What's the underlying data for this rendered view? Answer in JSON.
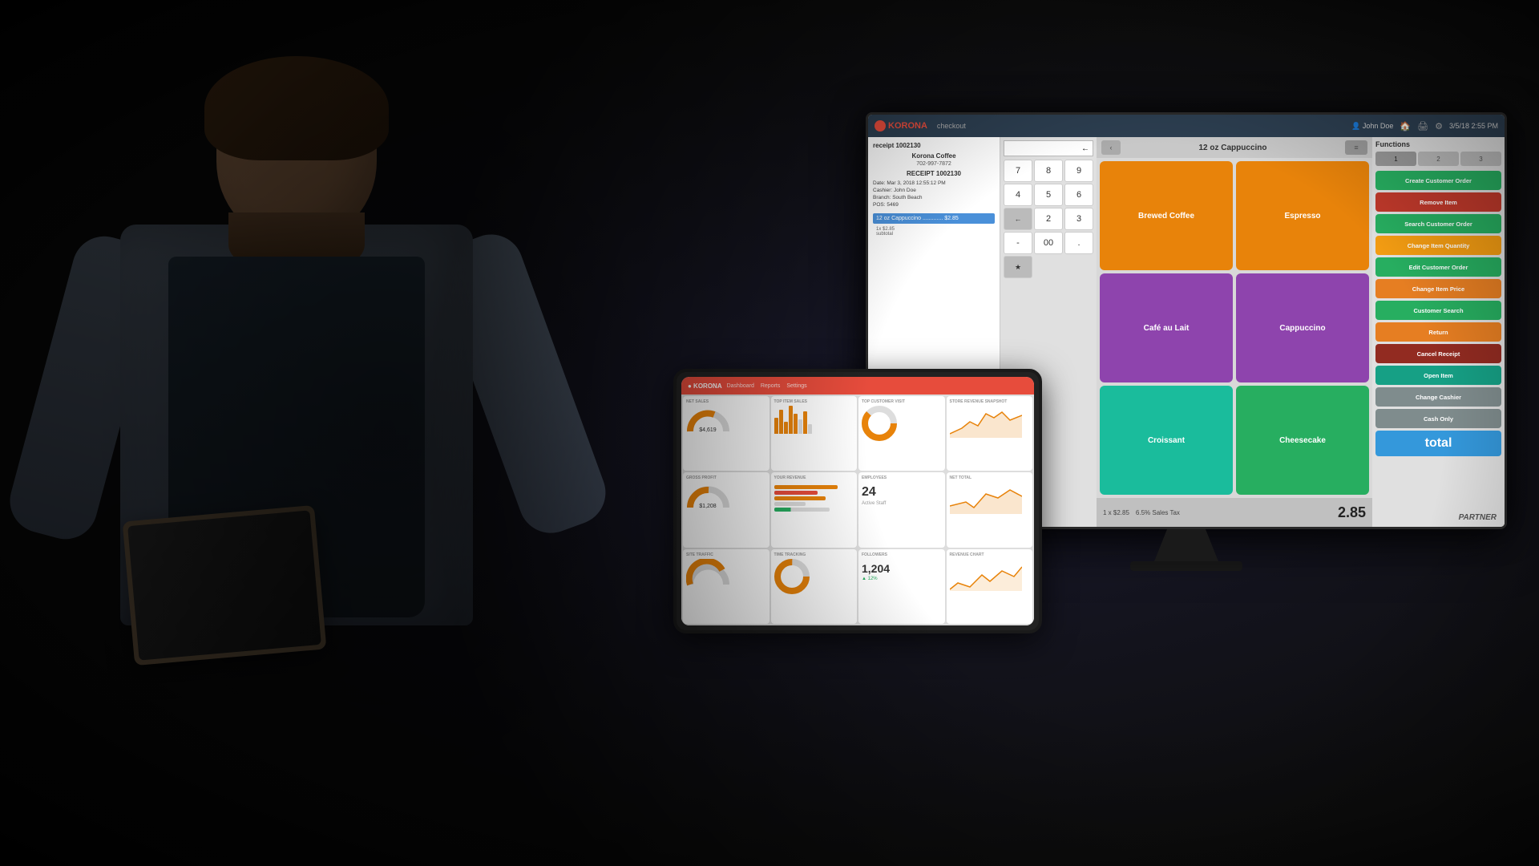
{
  "background": {
    "color": "#111111"
  },
  "pos_header": {
    "logo": "KORONA",
    "status": "checkout",
    "user": "John Doe",
    "time": "3/5/18 2:55 PM",
    "nav_icons": [
      "home",
      "print",
      "settings"
    ]
  },
  "receipt": {
    "title": "receipt 1002130",
    "shop_name": "Korona Coffee",
    "shop_address": "702-997-7872",
    "receipt_label": "RECEIPT 1002130",
    "date_label": "Date:",
    "date_value": "Mar 3, 2018 12:55:12 PM",
    "cashier_label": "Cashier:",
    "cashier_value": "John Doe",
    "branch_label": "Branch:",
    "branch_value": "South Beach",
    "pos_label": "POS:",
    "pos_value": "5469",
    "selected_item": "12 oz Cappuccino ............. $2.85",
    "item_detail1": "1x $2.85",
    "item_detail2": "subtotal"
  },
  "product_header": {
    "title": "12 oz Cappuccino"
  },
  "products": [
    {
      "label": "Brewed Coffee",
      "color": "orange"
    },
    {
      "label": "Espresso",
      "color": "orange"
    },
    {
      "label": "Café au Lait",
      "color": "purple"
    },
    {
      "label": "Cappuccino",
      "color": "purple"
    },
    {
      "label": "Croissant",
      "color": "teal"
    },
    {
      "label": "Cheesecake",
      "color": "green"
    }
  ],
  "numpad": {
    "buttons": [
      "7",
      "8",
      "9",
      "←",
      "4",
      "5",
      "6",
      "←",
      "2",
      "3",
      "-",
      "00",
      ".",
      "*"
    ]
  },
  "footer": {
    "quantity_info": "1 x $2.85",
    "tax_info": "6.5% Sales Tax",
    "total_amount": "2.85"
  },
  "functions": {
    "title": "Functions",
    "tabs": [
      "1",
      "2",
      "3"
    ],
    "buttons": [
      {
        "label": "Create Customer Order",
        "color": "green"
      },
      {
        "label": "Remove Item",
        "color": "red"
      },
      {
        "label": "Search Customer Order",
        "color": "green"
      },
      {
        "label": "Change Item Quantity",
        "color": "yellow"
      },
      {
        "label": "Edit Customer Order",
        "color": "green"
      },
      {
        "label": "Change Item Price",
        "color": "orange"
      },
      {
        "label": "Customer Search",
        "color": "green"
      },
      {
        "label": "Return",
        "color": "orange"
      },
      {
        "label": "Cancel Receipt",
        "color": "dark-red"
      },
      {
        "label": "Open Item",
        "color": "teal"
      },
      {
        "label": "Change Cashier",
        "color": "gray"
      },
      {
        "label": "Cash Only",
        "color": "gray"
      },
      {
        "label": "total",
        "color": "light-blue"
      }
    ]
  },
  "monitor_brand": "PARTNER",
  "tablet_dashboard": {
    "title": "Dashboard",
    "cards": [
      {
        "title": "NET SALES",
        "value": "$4,619",
        "chart": "gauge"
      },
      {
        "title": "TOP ITEM SALES",
        "chart": "bar"
      },
      {
        "title": "TOP CUSTOMER VISIT",
        "chart": "donut"
      },
      {
        "title": "STORE REVENUE SNAPSHOT",
        "chart": "line"
      },
      {
        "title": "GROSS PROFIT",
        "value": "$1,208",
        "chart": "gauge"
      },
      {
        "title": "YOUR REVENUE",
        "chart": "hbar"
      },
      {
        "title": "EMPLOYEES",
        "chart": "text"
      },
      {
        "title": "NET TOTAL",
        "chart": "line2"
      },
      {
        "title": "SITE TRAFFIC",
        "chart": "gauge2"
      },
      {
        "title": "TIME TRACKING",
        "chart": "donut2"
      },
      {
        "title": "FOLLOWERS",
        "chart": "text2"
      },
      {
        "title": "REVENUE CHART",
        "chart": "line3"
      }
    ]
  }
}
